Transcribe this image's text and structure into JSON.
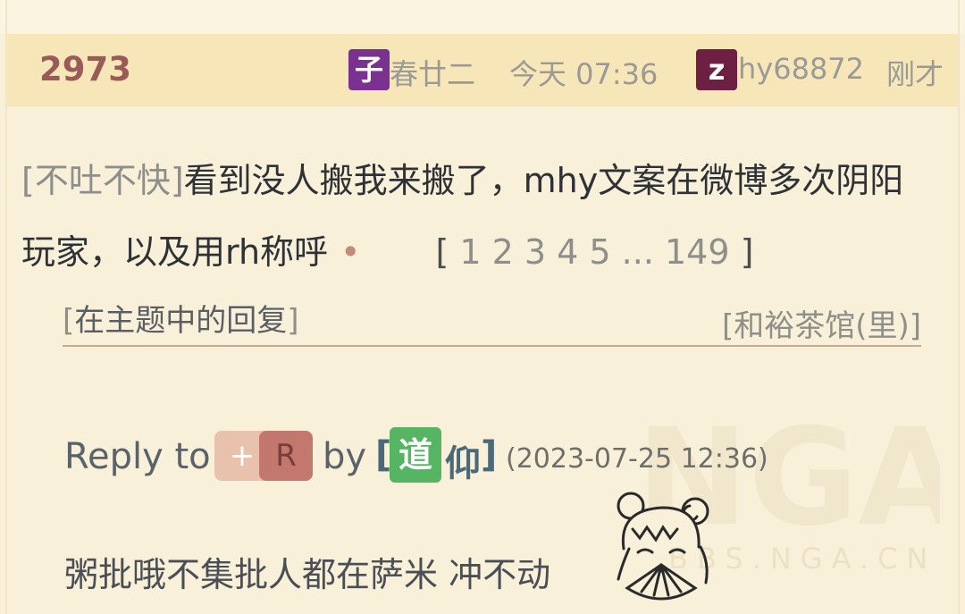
{
  "post": {
    "reply_count": "2973",
    "author_badge": "子",
    "author": "春廿二",
    "post_time": "今天 07:36",
    "last_badge": "z",
    "last_user": "hy68872",
    "last_time": "刚才",
    "tag": "[不吐不快]",
    "title": "看到没人搬我来搬了，mhy文案在微博多次阴阳玩家，以及用rh称呼",
    "dot": "•",
    "pages_open": "[",
    "pages": "1 2 3 4 5 ... 149",
    "pages_close": "]",
    "subtag_open": "[",
    "subtag": "在主题中的回复",
    "subtag_close": "]",
    "forum": "[和裕茶馆(里)]"
  },
  "reply": {
    "reply_to_label": "Reply to",
    "plus_label": "+",
    "r_label": "R",
    "by_label": "by",
    "user_badge": "道",
    "user_rest": "仰",
    "bracket_open": "[",
    "bracket_close": "]",
    "timestamp": "(2023-07-25 12:36)",
    "content": "粥批哦不集批人都在萨米 冲不动"
  },
  "watermark": {
    "logo_text": "NGA",
    "url_text": "BBS.NGA.CN"
  },
  "colors": {
    "background": "#f8f0d8",
    "header_band": "#f6e6b8",
    "reply_count": "#9a5a5a",
    "badge_purple": "#7b3190",
    "badge_maroon": "#6e1f44",
    "badge_green": "#55b563"
  },
  "icons": {
    "sticker": "chibi-girl-fan-sticker-icon"
  }
}
